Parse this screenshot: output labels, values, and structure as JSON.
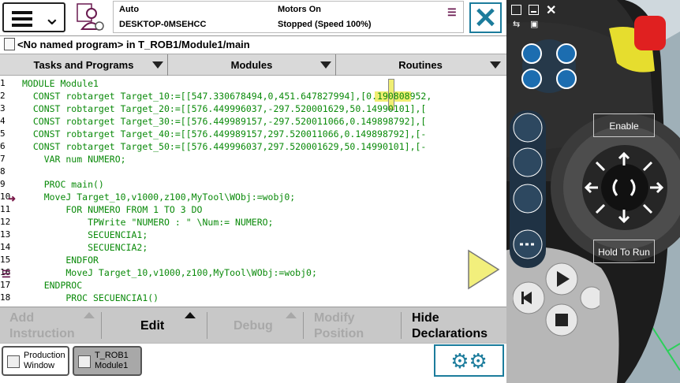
{
  "status": {
    "mode": "Auto",
    "host": "DESKTOP-0MSEHCC",
    "motors": "Motors On",
    "state": "Stopped (Speed 100%)"
  },
  "path": {
    "text": "<No named program> in T_ROB1/Module1/main"
  },
  "tabs": [
    {
      "label": "Tasks and Programs"
    },
    {
      "label": "Modules"
    },
    {
      "label": "Routines"
    }
  ],
  "code": {
    "lines": [
      {
        "n": "1",
        "text": "MODULE Module1"
      },
      {
        "n": "2",
        "text": "  CONST robtarget Target_10:=[[547.330678494,0,451.647827994],[0.190808952,"
      },
      {
        "n": "3",
        "text": "  CONST robtarget Target_20:=[[576.449996037,-297.520001629,50.14990101],["
      },
      {
        "n": "4",
        "text": "  CONST robtarget Target_30:=[[576.449989157,-297.520011066,0.149898792],["
      },
      {
        "n": "5",
        "text": "  CONST robtarget Target_40:=[[576.449989157,297.520011066,0.149898792],[-"
      },
      {
        "n": "6",
        "text": "  CONST robtarget Target_50:=[[576.449996037,297.520001629,50.14990101],[-"
      },
      {
        "n": "7",
        "text": "    VAR num NUMERO;"
      },
      {
        "n": "8",
        "text": ""
      },
      {
        "n": "9",
        "text": "    PROC main()"
      },
      {
        "n": "10",
        "text": "    MoveJ Target_10,v1000,z100,MyTool\\WObj:=wobj0;"
      },
      {
        "n": "11",
        "text": "        FOR NUMERO FROM 1 TO 3 DO"
      },
      {
        "n": "12",
        "text": "            TPWrite \"NUMERO : \" \\Num:= NUMERO;"
      },
      {
        "n": "13",
        "text": "            SECUENCIA1;"
      },
      {
        "n": "14",
        "text": "            SECUENCIA2;"
      },
      {
        "n": "15",
        "text": "        ENDFOR"
      },
      {
        "n": "16",
        "text": "        MoveJ Target_10,v1000,z100,MyTool\\WObj:=wobj0;"
      },
      {
        "n": "17",
        "text": "    ENDPROC"
      },
      {
        "n": "18",
        "text": "        PROC SECUENCIA1()"
      }
    ]
  },
  "actions": [
    {
      "label": "Add\nInstruction",
      "enabled": false
    },
    {
      "label": "Edit",
      "enabled": true
    },
    {
      "label": "Debug",
      "enabled": false
    },
    {
      "label": "Modify\nPosition",
      "enabled": false
    },
    {
      "label": "Hide\nDeclarations",
      "enabled": true
    }
  ],
  "taskbar": {
    "production": "Production\nWindow",
    "module": "T_ROB1\nModule1"
  },
  "pendant": {
    "enable": "Enable",
    "hold": "Hold To Run"
  },
  "colors": {
    "accent": "#1c7c9c",
    "code": "#0a8a0a",
    "jog_overlay": "#f2ef7c",
    "emergency_stop": "#e01c1c"
  }
}
